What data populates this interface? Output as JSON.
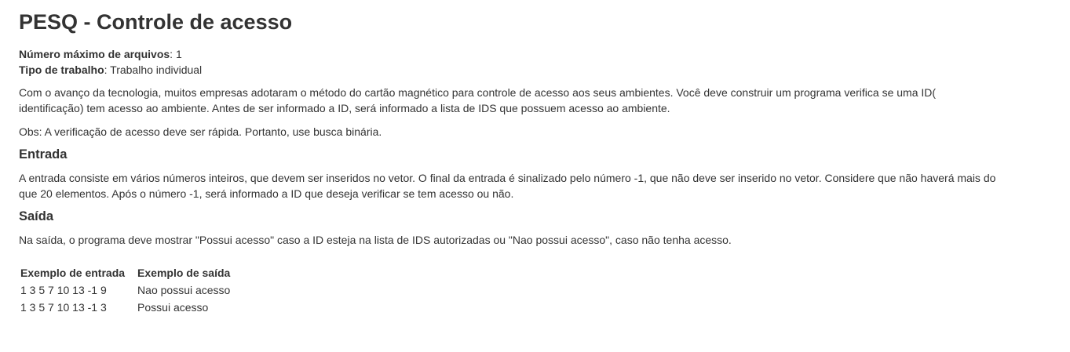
{
  "title": "PESQ - Controle de acesso",
  "meta": {
    "max_files_label": "Número máximo de arquivos",
    "max_files_value": ": 1",
    "work_type_label": "Tipo de trabalho",
    "work_type_value": ": Trabalho individual"
  },
  "description": "Com o avanço da tecnologia, muitos empresas adotaram o método do cartão magnético para controle de acesso aos seus ambientes. Você deve construir um programa verifica se uma ID( identificação) tem acesso ao ambiente. Antes de ser informado a ID, será informado a lista de IDS que possuem acesso ao ambiente.",
  "obs": "Obs: A verificação de acesso deve ser rápida. Portanto, use busca binária.",
  "input_section": {
    "heading": "Entrada",
    "text": "A entrada consiste em vários números inteiros, que devem ser inseridos no vetor. O final da entrada é sinalizado pelo número -1, que não deve ser inserido no vetor. Considere que não haverá mais do que 20 elementos. Após o número -1, será informado a ID que deseja verificar se tem acesso ou não."
  },
  "output_section": {
    "heading": "Saída",
    "text": "Na saída, o programa deve mostrar \"Possui acesso\" caso a ID esteja na lista de IDS autorizadas ou \"Nao possui acesso\", caso não tenha acesso."
  },
  "examples": {
    "headers": [
      "Exemplo de entrada",
      "Exemplo de saída"
    ],
    "rows": [
      [
        "1 3 5 7 10 13 -1 9",
        "Nao possui acesso"
      ],
      [
        "1 3 5 7 10 13 -1 3",
        "Possui acesso"
      ]
    ]
  }
}
